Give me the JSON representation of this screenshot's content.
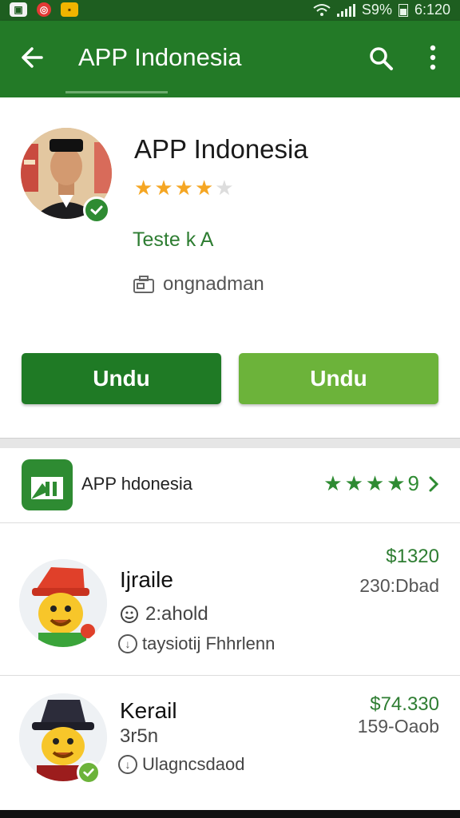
{
  "status_bar": {
    "battery": "S9%",
    "time": "6:120"
  },
  "app_bar": {
    "title": "APP Indonesia"
  },
  "profile": {
    "name": "APP Indonesia",
    "rating_stars": 4,
    "max_stars": 5,
    "tester_label": "Teste k A",
    "developer": "ongnadman",
    "buttons": {
      "primary": "Undu",
      "secondary": "Undu"
    }
  },
  "featured_app": {
    "name": "APP hdonesia",
    "rating_stars": 4,
    "rating_value": "9"
  },
  "list": [
    {
      "name": "Ijraile",
      "subtitle": "2:ahold",
      "meta": "taysiotij Fhhrlenn",
      "price": "$1320",
      "note": "230:Dbad"
    },
    {
      "name": "Kerail",
      "subtitle": "3r5n",
      "meta": "Ulagncsdaod",
      "price": "$74.330",
      "note": "159-Oaob"
    }
  ],
  "colors": {
    "primary": "#237a27",
    "status_bar": "#1e5e20",
    "accent_light": "#6cb33a",
    "star": "#f5a623"
  }
}
